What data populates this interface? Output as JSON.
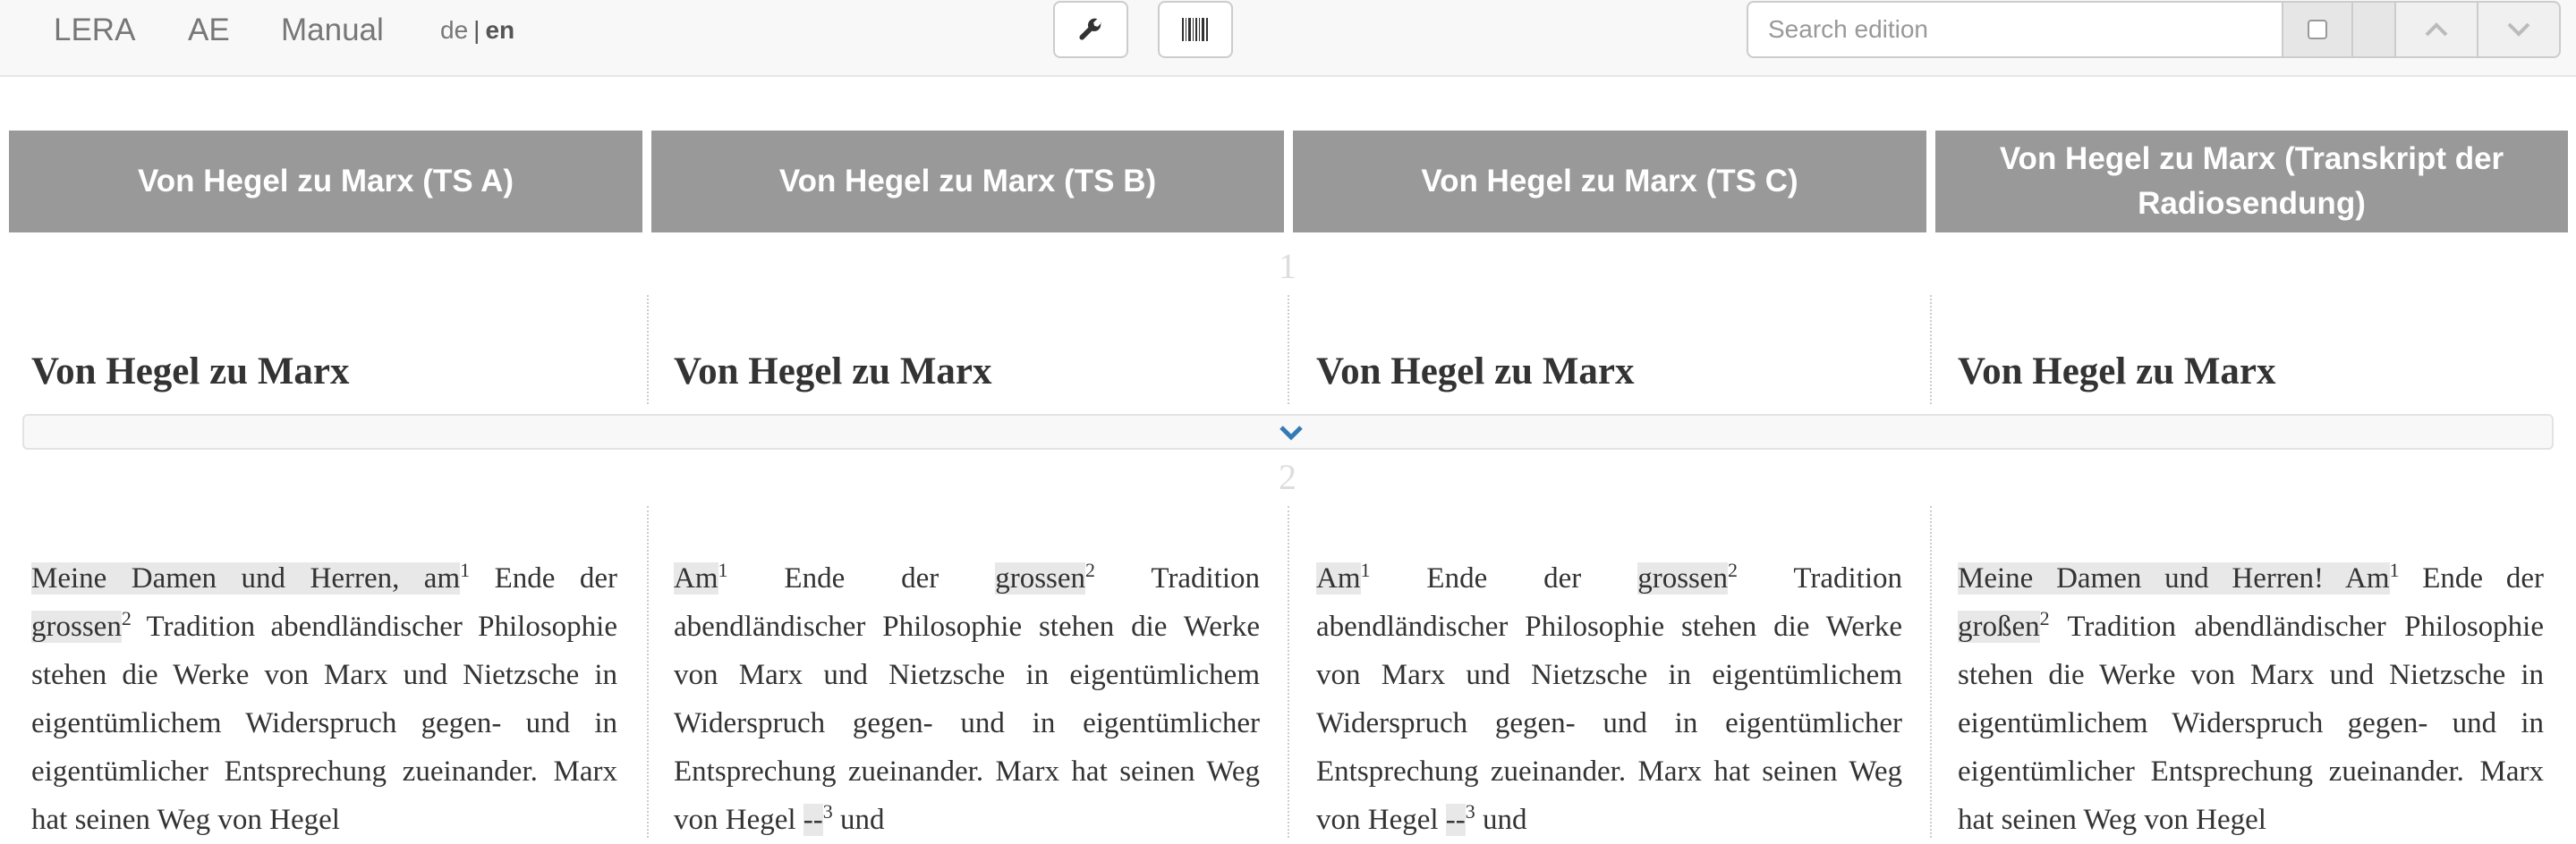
{
  "nav": {
    "links": [
      "LERA",
      "AE",
      "Manual"
    ],
    "lang": {
      "de": "de",
      "sep": "|",
      "en": "en",
      "active": "en"
    }
  },
  "toolbar": {
    "settings_icon": "wrench-icon",
    "barcode_icon": "barcode-icon"
  },
  "search": {
    "placeholder": "Search edition",
    "value": ""
  },
  "witnesses": [
    "Von Hegel zu Marx (TS A)",
    "Von Hegel zu Marx (TS B)",
    "Von Hegel zu Marx (TS C)",
    "Von Hegel zu Marx (Transkript der Radiosendung)"
  ],
  "segments": [
    {
      "number": "1",
      "titles": [
        "Von Hegel zu Marx",
        "Von Hegel zu Marx",
        "Von Hegel zu Marx",
        "Von Hegel zu Marx"
      ]
    },
    {
      "number": "2"
    }
  ],
  "text": {
    "a": {
      "var1": "Meine Damen und Herren, am",
      "n1": "1",
      "t1": " Ende der ",
      "var2": "grossen",
      "n2": "2",
      "t2": " Tradition abendländischer Philosophie stehen die Werke von Marx und Nietzsche in eigentümlichem Widerspruch gegen- und in eigentümlicher Entsprechung zueinander. Marx hat seinen Weg von Hegel"
    },
    "b": {
      "var1": "Am",
      "n1": "1",
      "t1": " Ende der ",
      "var2": "grossen",
      "n2": "2",
      "t2": " Tradition abendländischer Philosophie stehen die Werke von Marx und Nietzsche in eigentümlichem Widerspruch gegen- und in eigentümlicher Entsprechung zueinander. Marx hat seinen Weg von Hegel ",
      "var3": "--",
      "n3": "3",
      "t3": " und"
    },
    "c": {
      "var1": "Am",
      "n1": "1",
      "t1": " Ende der ",
      "var2": "grossen",
      "n2": "2",
      "t2": " Tradition abendländischer Philosophie stehen die Werke von Marx und Nietzsche in eigentümlichem Widerspruch gegen- und in eigentümlicher Entsprechung zueinander. Marx hat seinen Weg von Hegel ",
      "var3": "--",
      "n3": "3",
      "t3": " und"
    },
    "d": {
      "var1": "Meine Damen und Herren! Am",
      "n1": "1",
      "t1": " Ende der ",
      "var2": "großen",
      "n2": "2",
      "t2": " Tradition abendländischer Philosophie stehen die Werke von Marx und Nietzsche in eigentümlichem Widerspruch gegen- und in eigentümlicher Entsprechung zueinander. Marx hat seinen Weg von Hegel"
    }
  }
}
